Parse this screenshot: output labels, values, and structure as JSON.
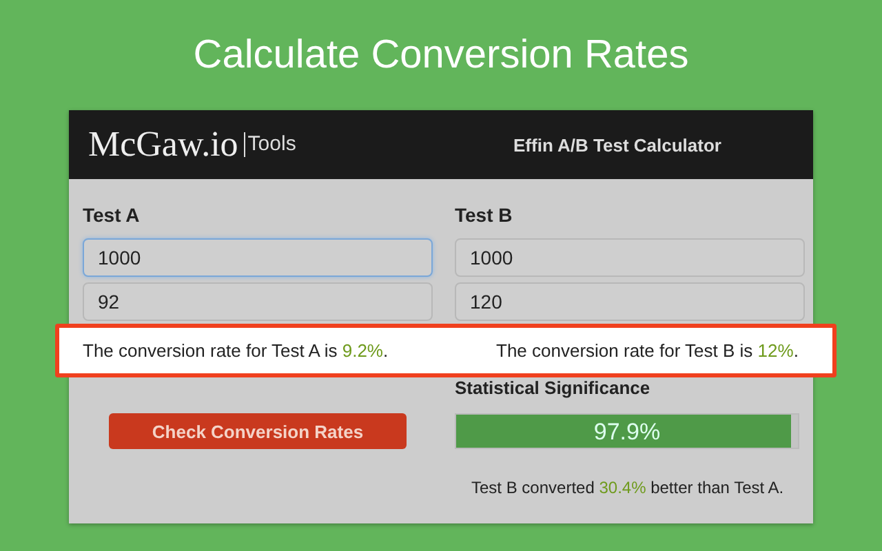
{
  "headline": "Calculate Conversion Rates",
  "header": {
    "logo": "McGaw.io",
    "logo_suffix": "Tools",
    "title": "Effin A/B Test Calculator"
  },
  "tests": [
    {
      "label": "Test A",
      "inputs": [
        {
          "value": "1000",
          "focused": true
        },
        {
          "value": "92",
          "focused": false
        }
      ],
      "result": {
        "prefix": "The conversion rate for Test A is ",
        "value": "9.2%",
        "suffix": "."
      }
    },
    {
      "label": "Test B",
      "inputs": [
        {
          "value": "1000",
          "focused": false
        },
        {
          "value": "120",
          "focused": false
        }
      ],
      "result": {
        "prefix": "The conversion rate for Test B is ",
        "value": "12%",
        "suffix": "."
      }
    }
  ],
  "button": "Check Conversion Rates",
  "significance": {
    "label": "Statistical Significance",
    "level": 0.979,
    "reading": "97.9%",
    "summary": {
      "prefix": "Test B converted ",
      "value": "30.4%",
      "suffix": " better than Test A."
    }
  }
}
